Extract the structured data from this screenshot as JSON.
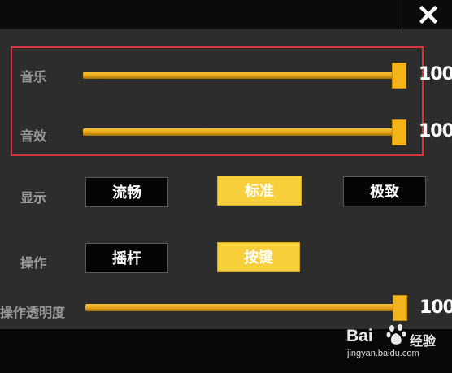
{
  "header": {
    "close_icon": "close-x-icon"
  },
  "audio": {
    "music": {
      "label": "音乐",
      "value": 100,
      "max": 100,
      "display": "100"
    },
    "sfx": {
      "label": "音效",
      "value": 100,
      "max": 100,
      "display": "100"
    }
  },
  "display": {
    "label": "显示",
    "options": [
      {
        "label": "流畅",
        "selected": false
      },
      {
        "label": "标准",
        "selected": true
      },
      {
        "label": "极致",
        "selected": false
      }
    ]
  },
  "control": {
    "label": "操作",
    "options": [
      {
        "label": "摇杆",
        "selected": false
      },
      {
        "label": "按键",
        "selected": true
      }
    ]
  },
  "opacity": {
    "label": "操作透明度",
    "value": 100,
    "max": 100,
    "display": "100"
  },
  "watermark": {
    "logo_text": "Bai",
    "brand": "经验",
    "url": "jingyan.baidu.com"
  },
  "colors": {
    "accent": "#f2b418",
    "selected_button": "#f7cf3a",
    "highlight_border": "#d9353a"
  }
}
